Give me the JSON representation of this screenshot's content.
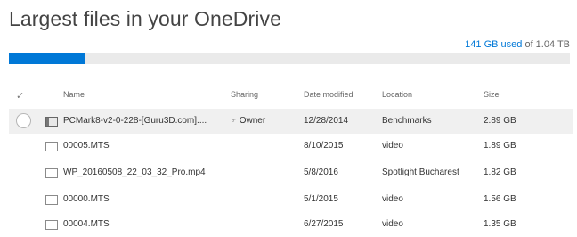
{
  "title": "Largest files in your OneDrive",
  "storage": {
    "used": "141 GB used",
    "of_total": " of 1.04 TB",
    "fill_fraction": 0.135
  },
  "columns": {
    "name": "Name",
    "sharing": "Sharing",
    "date_modified": "Date modified",
    "location": "Location",
    "size": "Size"
  },
  "rows": [
    {
      "name": "PCMark8-v2-0-228-[Guru3D.com]....",
      "sharing": "Owner",
      "date": "12/28/2014",
      "location": "Benchmarks",
      "size": "2.89 GB",
      "icon": "zip-file-icon"
    },
    {
      "name": "00005.MTS",
      "sharing": "",
      "date": "8/10/2015",
      "location": "video",
      "size": "1.89 GB",
      "icon": "video-file-icon"
    },
    {
      "name": "WP_20160508_22_03_32_Pro.mp4",
      "sharing": "",
      "date": "5/8/2016",
      "location": "Spotlight Bucharest",
      "size": "1.82 GB",
      "icon": "video-file-icon"
    },
    {
      "name": "00000.MTS",
      "sharing": "",
      "date": "5/1/2015",
      "location": "video",
      "size": "1.56 GB",
      "icon": "video-file-icon"
    },
    {
      "name": "00004.MTS",
      "sharing": "",
      "date": "6/27/2015",
      "location": "video",
      "size": "1.35 GB",
      "icon": "video-file-icon"
    }
  ],
  "colors": {
    "accent": "#0078d7",
    "track": "#eaeaea",
    "selected_row": "#f0f0f0"
  }
}
